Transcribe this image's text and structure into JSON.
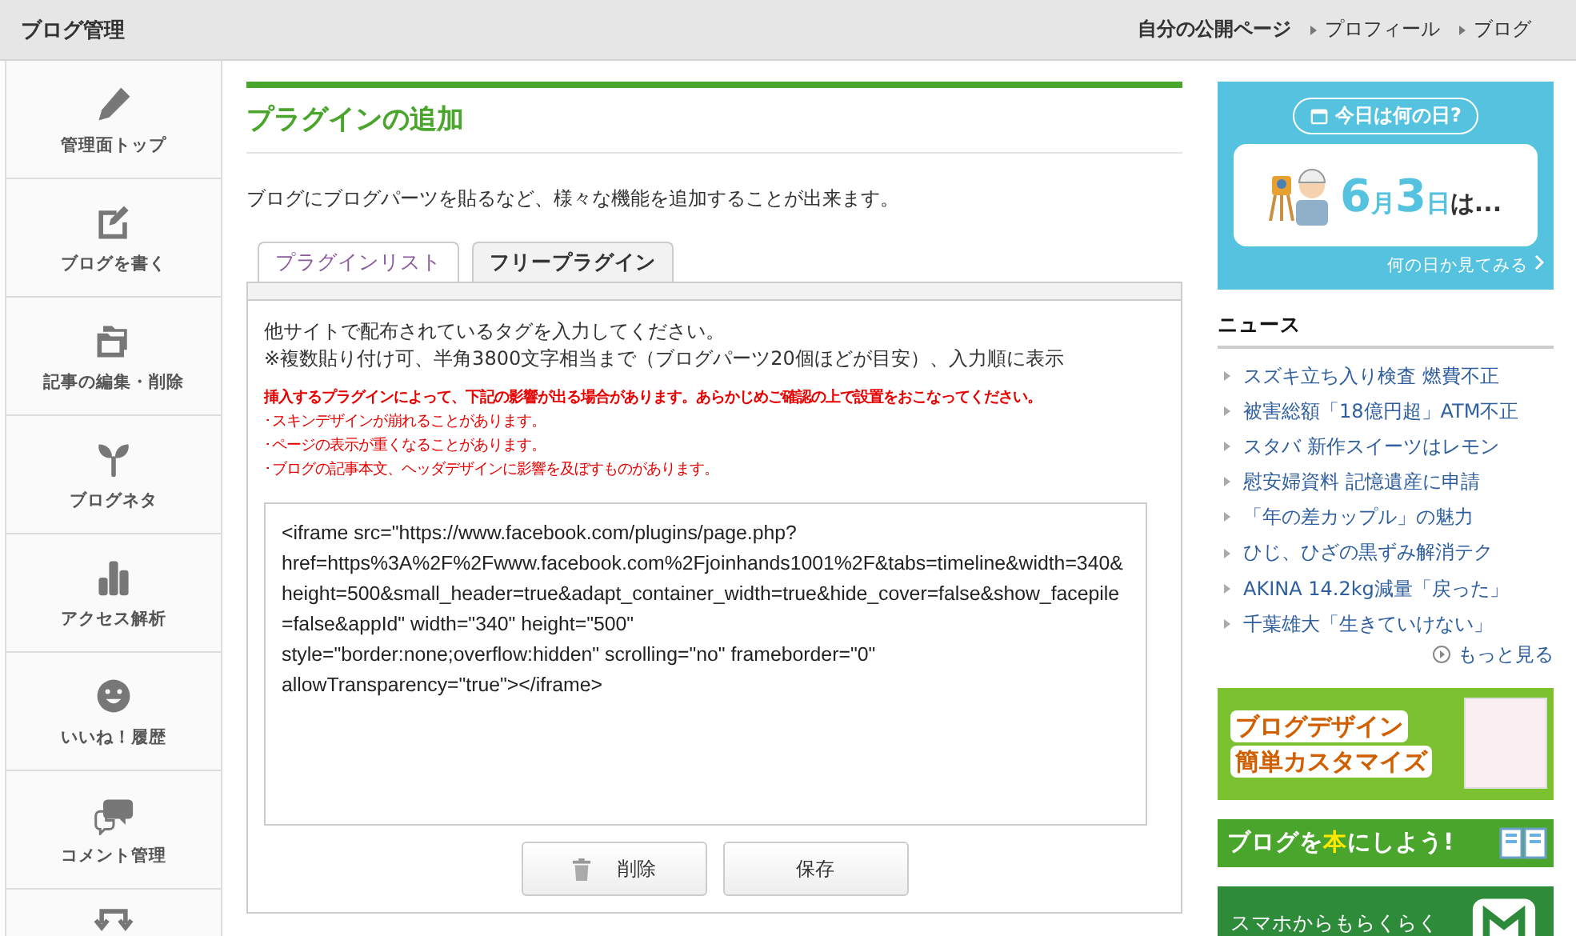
{
  "header": {
    "title": "ブログ管理",
    "links": [
      {
        "label": "自分の公開ページ",
        "kind": "bold"
      },
      {
        "label": "プロフィール",
        "kind": "arrow"
      },
      {
        "label": "ブログ",
        "kind": "arrow"
      }
    ]
  },
  "sidebar": {
    "items": [
      {
        "kind": "pencil",
        "label": "管理面トップ"
      },
      {
        "kind": "edit",
        "label": "ブログを書く"
      },
      {
        "kind": "folders",
        "label": "記事の編集・削除"
      },
      {
        "kind": "sprout",
        "label": "ブログネタ"
      },
      {
        "kind": "bars",
        "label": "アクセス解析"
      },
      {
        "kind": "smile",
        "label": "いいね！履歴"
      },
      {
        "kind": "chat",
        "label": "コメント管理"
      },
      {
        "kind": "swap"
      }
    ]
  },
  "main": {
    "title": "プラグインの追加",
    "description": "ブログにブログパーツを貼るなど、様々な機能を追加することが出来ます。",
    "tabs": [
      {
        "label": "プラグインリスト",
        "selected": false
      },
      {
        "label": "フリープラグイン",
        "selected": true
      }
    ],
    "instructions": [
      "他サイトで配布されているタグを入力してください。",
      "※複数貼り付け可、半角3800文字相当まで（ブログパーツ20個ほどが目安）、入力順に表示"
    ],
    "warning": {
      "title": "挿入するプラグインによって、下記の影響が出る場合があります。あらかじめご確認の上で設置をおこなってください。",
      "items": [
        "･スキンデザインが崩れることがあります。",
        "･ページの表示が重くなることがあります。",
        "･ブログの記事本文、ヘッダデザインに影響を及ぼすものがあります。"
      ]
    },
    "code_field": {
      "value": "<iframe src=\"https://www.facebook.com/plugins/page.php?\nhref=https%3A%2F%2Fwww.facebook.com%2Fjoinhands1001%2F&tabs=timeline&width=340&height=500&small_header=true&adapt_container_width=true&hide_cover=false&show_facepile=false&appId\" width=\"340\" height=\"500\"\nstyle=\"border:none;overflow:hidden\" scrolling=\"no\" frameborder=\"0\"\nallowTransparency=\"true\"></iframe>"
    },
    "buttons": [
      {
        "label": "削除",
        "kind": "delete"
      },
      {
        "label": "保存",
        "kind": "save"
      }
    ]
  },
  "right": {
    "today": {
      "bubble": "今日は何の日?",
      "date_parts": [
        {
          "text": "6",
          "kind": "num"
        },
        {
          "text": "月",
          "kind": "unit"
        },
        {
          "text": "3",
          "kind": "num"
        },
        {
          "text": "日",
          "kind": "unit"
        },
        {
          "text": "は...",
          "kind": "suffix"
        }
      ],
      "link": "何の日か見てみる"
    },
    "news": {
      "title": "ニュース",
      "items": [
        "スズキ立ち入り検査 燃費不正",
        "被害総額「18億円超」ATM不正",
        "スタバ 新作スイーツはレモン",
        "慰安婦資料 記憶遺産に申請",
        "「年の差カップル」の魅力",
        "ひじ、ひざの黒ずみ解消テク",
        "AKINA 14.2kg減量「戻った」",
        "千葉雄大「生きていけない」"
      ],
      "more": "もっと見る"
    },
    "banners": [
      {
        "kind": "design",
        "lines": [
          "ブログデザイン",
          "簡単カスタマイズ"
        ]
      },
      {
        "kind": "book",
        "parts": [
          {
            "text": "ブログを",
            "highlight": false
          },
          {
            "text": "本",
            "highlight": true
          },
          {
            "text": "にしよう!",
            "highlight": false
          }
        ]
      },
      {
        "kind": "phone",
        "lines": [
          "スマホからもらくらく"
        ]
      }
    ]
  }
}
